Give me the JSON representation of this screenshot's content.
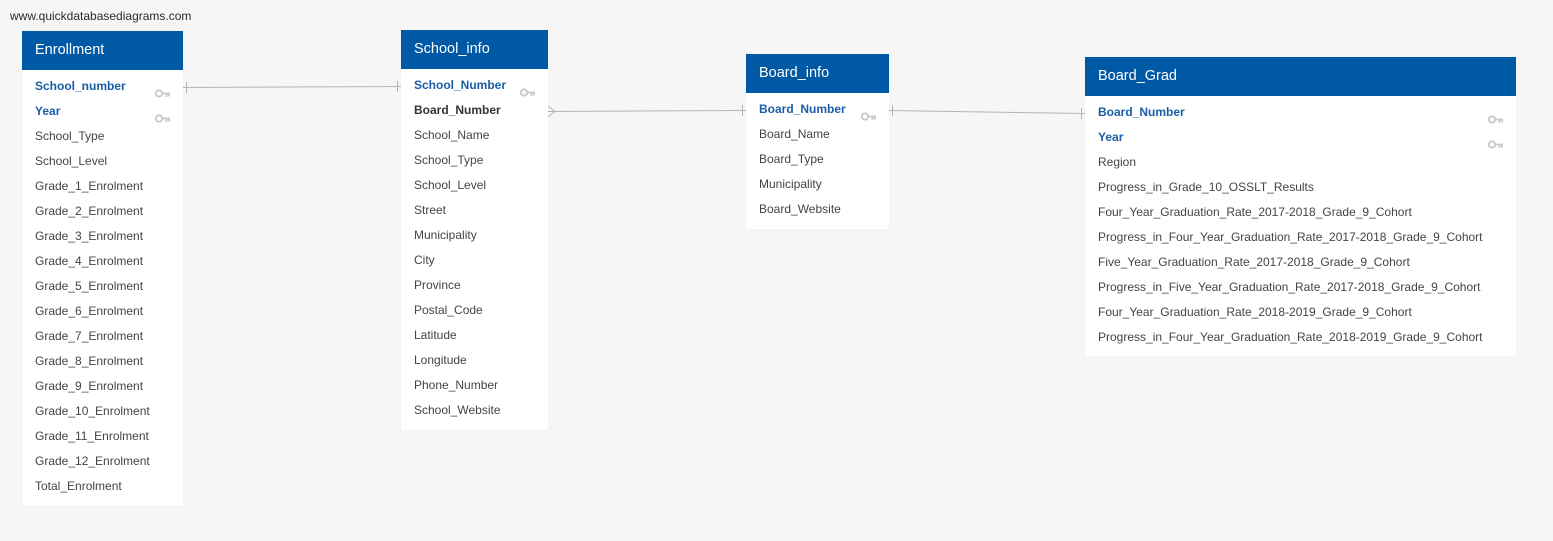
{
  "watermark": "www.quickdatabasediagrams.com",
  "colors": {
    "header_bg": "#0059a4",
    "primary_key_text": "#1b5ea6",
    "link_line": "#b4b4b4",
    "key_icon": "#c8c8c8"
  },
  "tables": [
    {
      "title": "Enrollment",
      "columns": [
        {
          "name": "School_number",
          "role": "pk",
          "icon": "key-icon"
        },
        {
          "name": "Year",
          "role": "pk",
          "icon": "key-icon"
        },
        {
          "name": "School_Type"
        },
        {
          "name": "School_Level"
        },
        {
          "name": "Grade_1_Enrolment"
        },
        {
          "name": "Grade_2_Enrolment"
        },
        {
          "name": "Grade_3_Enrolment"
        },
        {
          "name": "Grade_4_Enrolment"
        },
        {
          "name": "Grade_5_Enrolment"
        },
        {
          "name": "Grade_6_Enrolment"
        },
        {
          "name": "Grade_7_Enrolment"
        },
        {
          "name": "Grade_8_Enrolment"
        },
        {
          "name": "Grade_9_Enrolment"
        },
        {
          "name": "Grade_10_Enrolment"
        },
        {
          "name": "Grade_11_Enrolment"
        },
        {
          "name": "Grade_12_Enrolment"
        },
        {
          "name": "Total_Enrolment"
        }
      ]
    },
    {
      "title": "School_info",
      "columns": [
        {
          "name": "School_Number",
          "role": "pk",
          "icon": "key-icon"
        },
        {
          "name": "Board_Number",
          "role": "fk"
        },
        {
          "name": "School_Name"
        },
        {
          "name": "School_Type"
        },
        {
          "name": "School_Level"
        },
        {
          "name": "Street"
        },
        {
          "name": "Municipality"
        },
        {
          "name": "City"
        },
        {
          "name": "Province"
        },
        {
          "name": "Postal_Code"
        },
        {
          "name": "Latitude"
        },
        {
          "name": "Longitude"
        },
        {
          "name": "Phone_Number"
        },
        {
          "name": "School_Website"
        }
      ]
    },
    {
      "title": "Board_info",
      "columns": [
        {
          "name": "Board_Number",
          "role": "pk",
          "icon": "key-icon"
        },
        {
          "name": "Board_Name"
        },
        {
          "name": "Board_Type"
        },
        {
          "name": "Municipality"
        },
        {
          "name": "Board_Website"
        }
      ]
    },
    {
      "title": "Board_Grad",
      "columns": [
        {
          "name": "Board_Number",
          "role": "pk",
          "icon": "key-icon"
        },
        {
          "name": "Year",
          "role": "pk",
          "icon": "key-icon"
        },
        {
          "name": "Region"
        },
        {
          "name": "Progress_in_Grade_10_OSSLT_Results"
        },
        {
          "name": "Four_Year_Graduation_Rate_2017-2018_Grade_9_Cohort"
        },
        {
          "name": "Progress_in_Four_Year_Graduation_Rate_2017-2018_Grade_9_Cohort"
        },
        {
          "name": "Five_Year_Graduation_Rate_2017-2018_Grade_9_Cohort"
        },
        {
          "name": "Progress_in_Five_Year_Graduation_Rate_2017-2018_Grade_9_Cohort"
        },
        {
          "name": "Four_Year_Graduation_Rate_2018-2019_Grade_9_Cohort"
        },
        {
          "name": "Progress_in_Four_Year_Graduation_Rate_2018-2019_Grade_9_Cohort"
        }
      ]
    }
  ],
  "relationships": [
    {
      "from_table": "Enrollment",
      "from_column": "School_number",
      "from_end": "one",
      "to_table": "School_info",
      "to_column": "School_Number",
      "to_end": "one"
    },
    {
      "from_table": "School_info",
      "from_column": "Board_Number",
      "from_end": "many",
      "to_table": "Board_info",
      "to_column": "Board_Number",
      "to_end": "one"
    },
    {
      "from_table": "Board_info",
      "from_column": "Board_Number",
      "from_end": "one",
      "to_table": "Board_Grad",
      "to_column": "Board_Number",
      "to_end": "one"
    }
  ]
}
